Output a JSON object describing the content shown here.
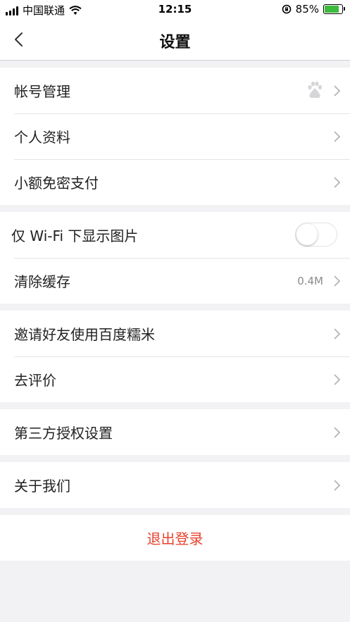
{
  "status_bar": {
    "carrier": "中国联通",
    "time": "12:15",
    "battery_percent": "85%",
    "battery_level": 0.85,
    "icons": [
      "signal-icon",
      "wifi-icon",
      "rotation-lock-icon",
      "battery-charging-icon"
    ]
  },
  "nav": {
    "title": "设置",
    "back_icon": "chevron-left-icon"
  },
  "groups": [
    {
      "items": [
        {
          "label": "帐号管理",
          "accessory": "baidu-paw-icon"
        },
        {
          "label": "个人资料"
        },
        {
          "label": "小额免密支付"
        }
      ]
    },
    {
      "items": [
        {
          "label": "仅 Wi-Fi 下显示图片",
          "toggle": false
        },
        {
          "label": "清除缓存",
          "value": "0.4M"
        }
      ]
    },
    {
      "items": [
        {
          "label": "邀请好友使用百度糯米"
        },
        {
          "label": "去评价"
        }
      ]
    },
    {
      "items": [
        {
          "label": "第三方授权设置"
        }
      ]
    },
    {
      "items": [
        {
          "label": "关于我们"
        }
      ]
    }
  ],
  "logout": {
    "label": "退出登录"
  },
  "colors": {
    "accent_red": "#e8412c",
    "background": "#f2f2f4",
    "toggle_off": "#ffffff"
  }
}
